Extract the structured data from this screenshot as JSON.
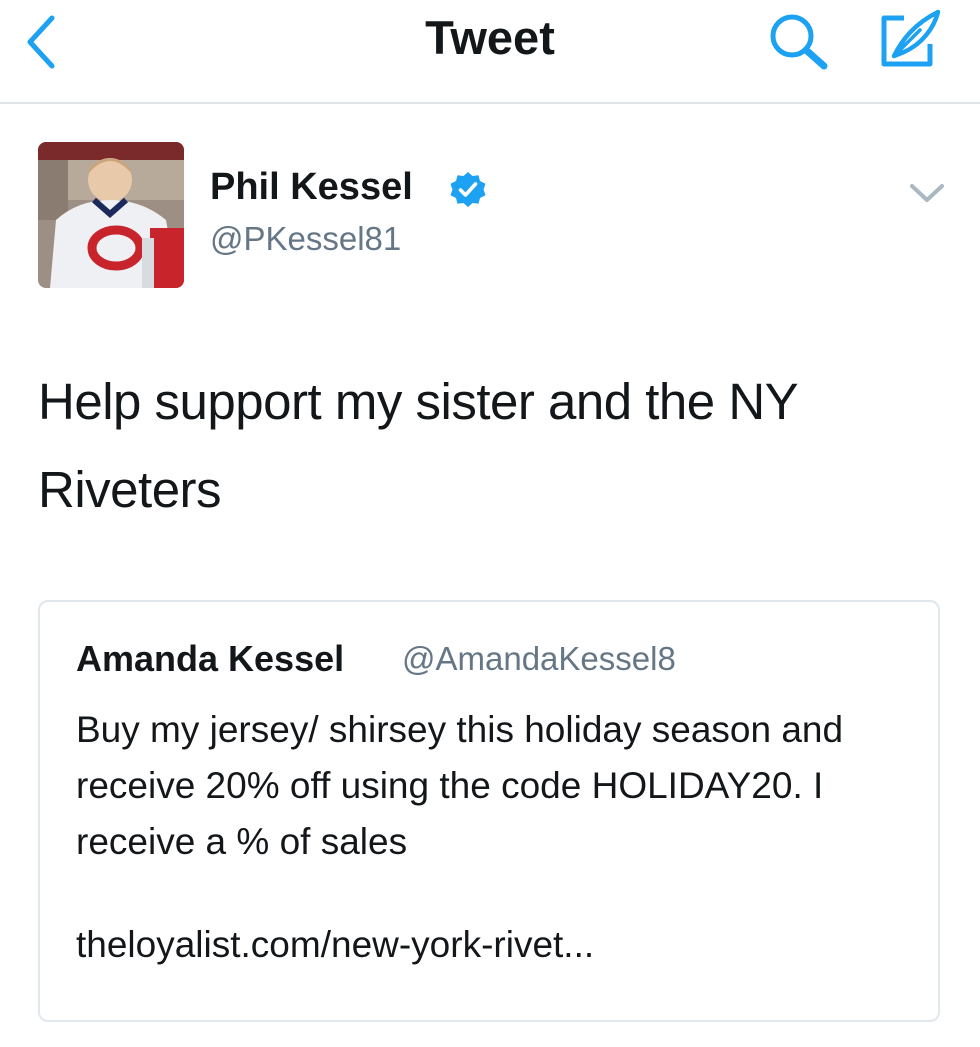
{
  "nav": {
    "title": "Tweet",
    "back_icon": "chevron-left-icon",
    "search_icon": "search-icon",
    "compose_icon": "compose-icon",
    "accent_color": "#1da1f2"
  },
  "tweet": {
    "author_name": "Phil Kessel",
    "author_handle": "@PKessel81",
    "verified": true,
    "text": "Help support my sister and the NY Riveters",
    "menu_icon": "chevron-down-icon"
  },
  "quoted_tweet": {
    "author_name": "Amanda Kessel",
    "author_handle": "@AmandaKessel8",
    "text": "Buy my jersey/ shirsey this holiday season and receive 20% off using the code HOLIDAY20. I receive a % of sales",
    "link": "theloyalist.com/new-york-rivet..."
  }
}
